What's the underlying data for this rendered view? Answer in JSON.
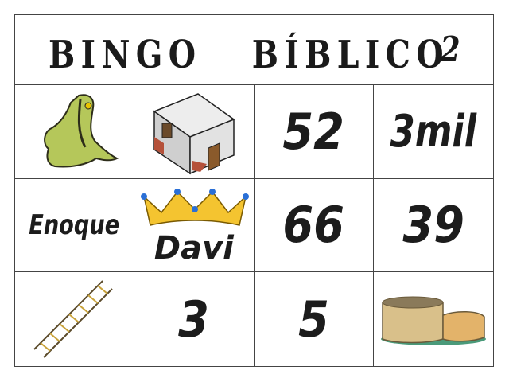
{
  "title": "BINGO   BÍBLICO",
  "card_number": "2",
  "cells": [
    {
      "type": "image",
      "icon": "frog-icon"
    },
    {
      "type": "image",
      "icon": "house-icon"
    },
    {
      "type": "text",
      "text": "52"
    },
    {
      "type": "text",
      "text": "3mil"
    },
    {
      "type": "text",
      "text": "Enoque"
    },
    {
      "type": "image-text",
      "icon": "crown-icon",
      "text": "Davi"
    },
    {
      "type": "text",
      "text": "66"
    },
    {
      "type": "text",
      "text": "39"
    },
    {
      "type": "image",
      "icon": "ladder-icon"
    },
    {
      "type": "text",
      "text": "3"
    },
    {
      "type": "text",
      "text": "5"
    },
    {
      "type": "image",
      "icon": "well-icon"
    }
  ]
}
